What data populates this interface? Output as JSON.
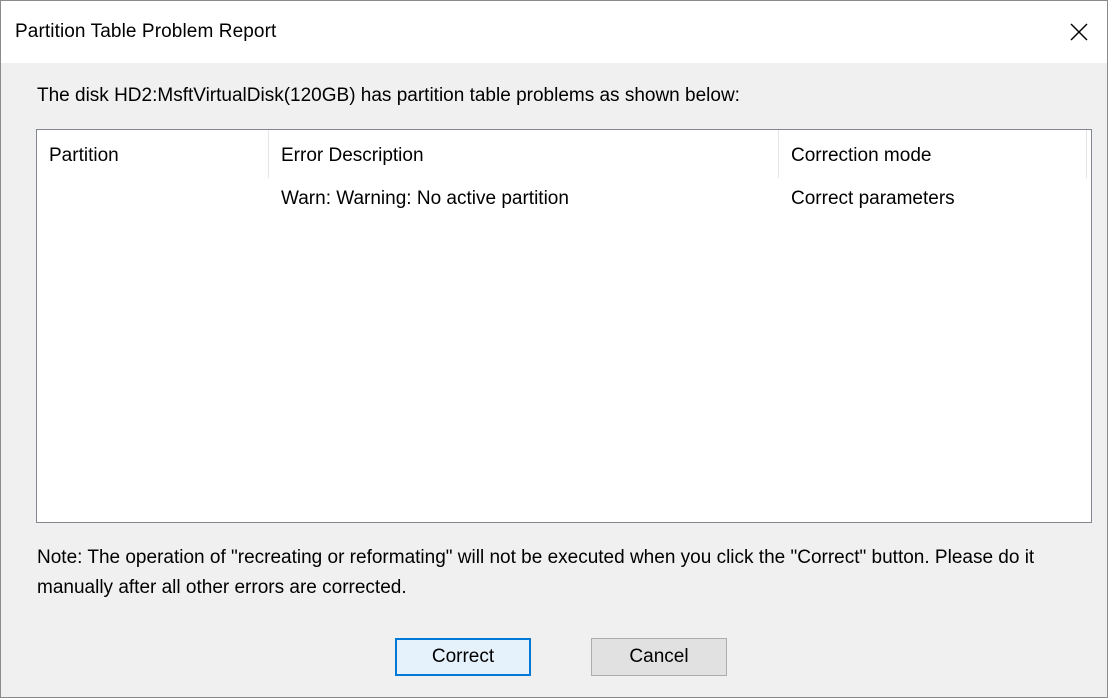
{
  "window": {
    "title": "Partition Table Problem Report",
    "close_icon": "close-icon"
  },
  "intro_text": "The disk HD2:MsftVirtualDisk(120GB) has partition table problems as shown below:",
  "table": {
    "columns": [
      "Partition",
      "Error Description",
      "Correction mode"
    ],
    "rows": [
      {
        "partition": "",
        "error": "Warn: Warning: No active partition",
        "mode": "Correct parameters"
      }
    ]
  },
  "note_text": "Note: The operation of \"recreating or reformating\" will not be executed when you click the \"Correct\" button. Please do it manually after all other errors are corrected.",
  "buttons": {
    "correct": "Correct",
    "cancel": "Cancel"
  },
  "colors": {
    "accent": "#0078d7",
    "dialog_bg": "#f0f0f0",
    "list_bg": "#ffffff"
  }
}
